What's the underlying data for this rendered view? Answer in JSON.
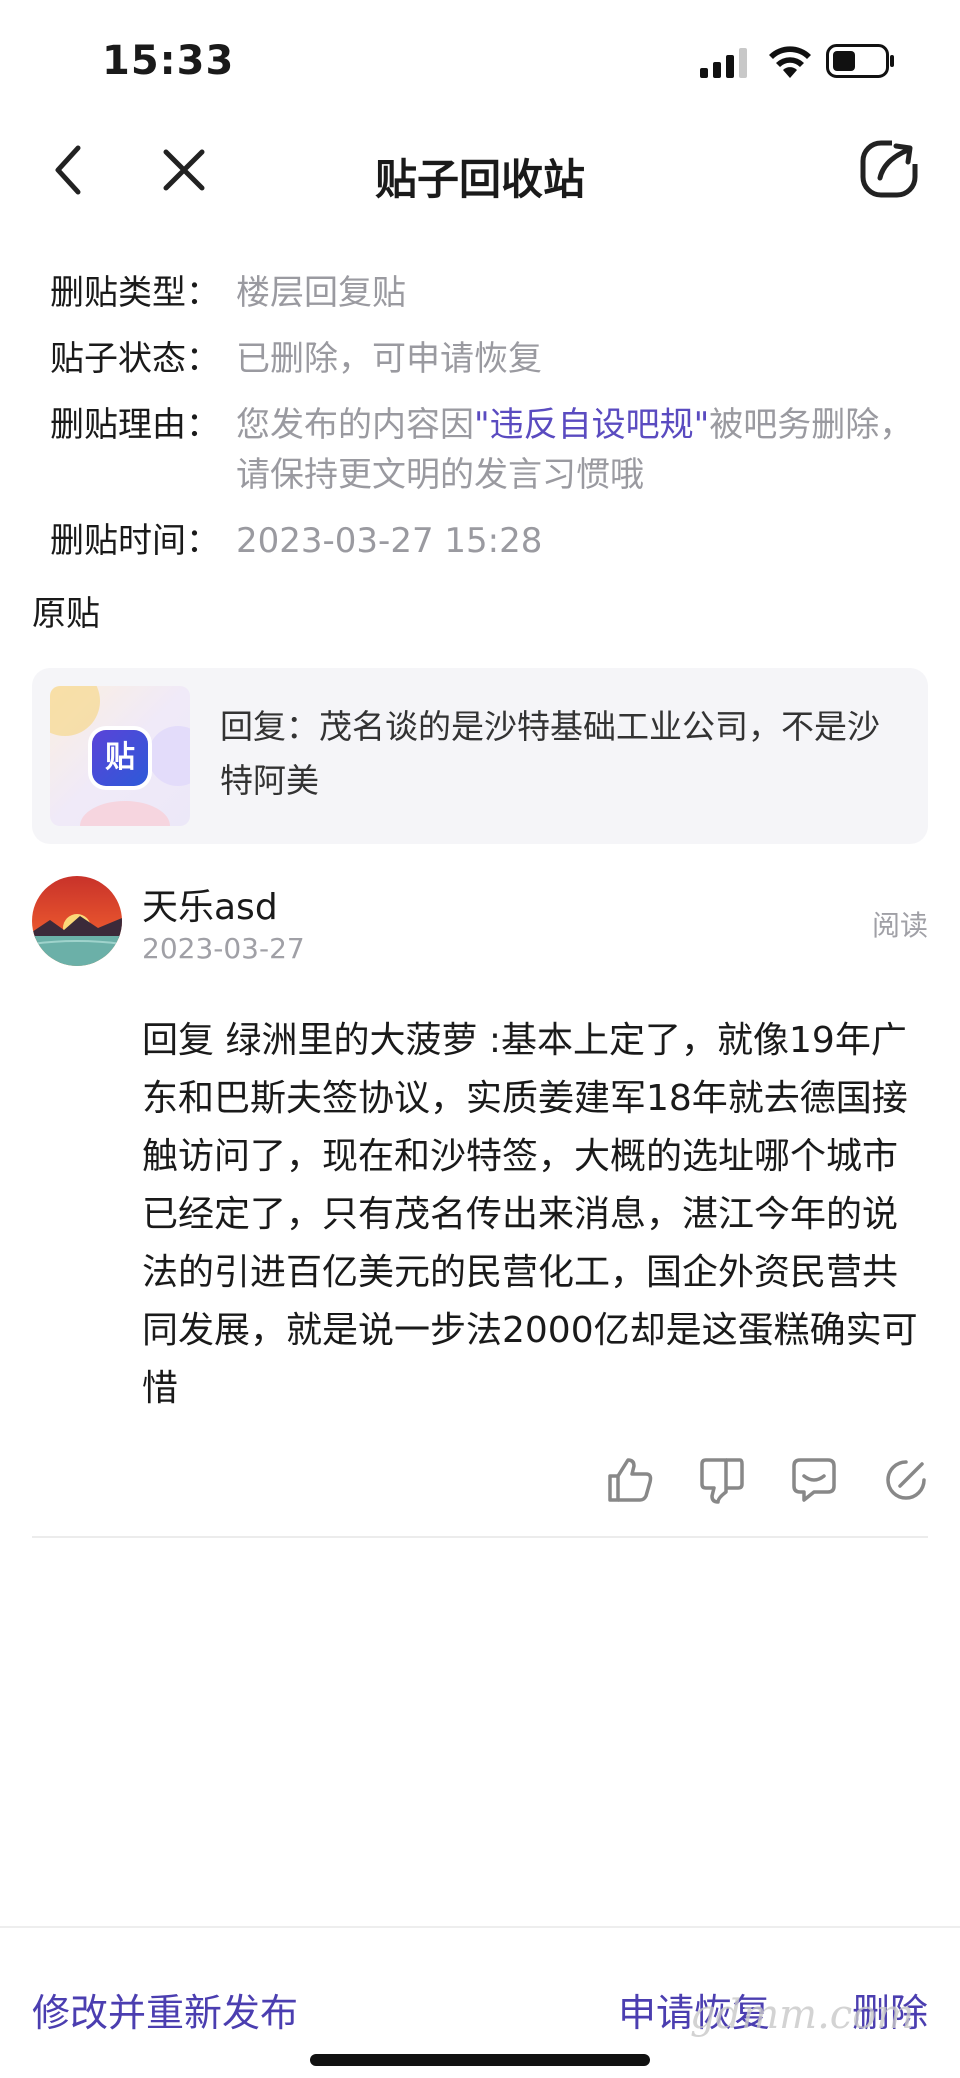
{
  "status_bar": {
    "time": "15:33"
  },
  "nav": {
    "title": "贴子回收站"
  },
  "info": [
    {
      "label": "删贴类型：",
      "value": "楼层回复贴"
    },
    {
      "label": "贴子状态：",
      "value": "已删除，可申请恢复"
    },
    {
      "label": "删贴时间：",
      "value": "2023-03-27 15:28"
    }
  ],
  "reason": {
    "label": "删贴理由：",
    "prefix": "您发布的内容因",
    "link": "\"违反自设吧规\"",
    "suffix": "被吧务删除，请保持更文明的发言习惯哦"
  },
  "original": {
    "section_label": "原贴",
    "thumb_logo": "贴",
    "text": "回复：茂名谈的是沙特基础工业公司，不是沙特阿美"
  },
  "comment": {
    "username": "天乐asd",
    "date": "2023-03-27",
    "read_label": "阅读",
    "body": "  回复  绿洲里的大菠萝 :基本上定了，就像19年广东和巴斯夫签协议，实质姜建军18年就去德国接触访问了，现在和沙特签，大概的选址哪个城市已经定了，只有茂名传出来消息，湛江今年的说法的引进百亿美元的民营化工，国企外资民营共同发展，就是说一步法2000亿却是这蛋糕确实可惜"
  },
  "actions": [
    "like-icon",
    "dislike-icon",
    "comment-icon",
    "edit-icon"
  ],
  "bottom": {
    "repost": "修改并重新发布",
    "restore": "申请恢复",
    "delete": "删除",
    "watermark": "gdmm.com"
  },
  "colors": {
    "accent": "#4b3eb0",
    "muted": "#9a9aa0"
  }
}
